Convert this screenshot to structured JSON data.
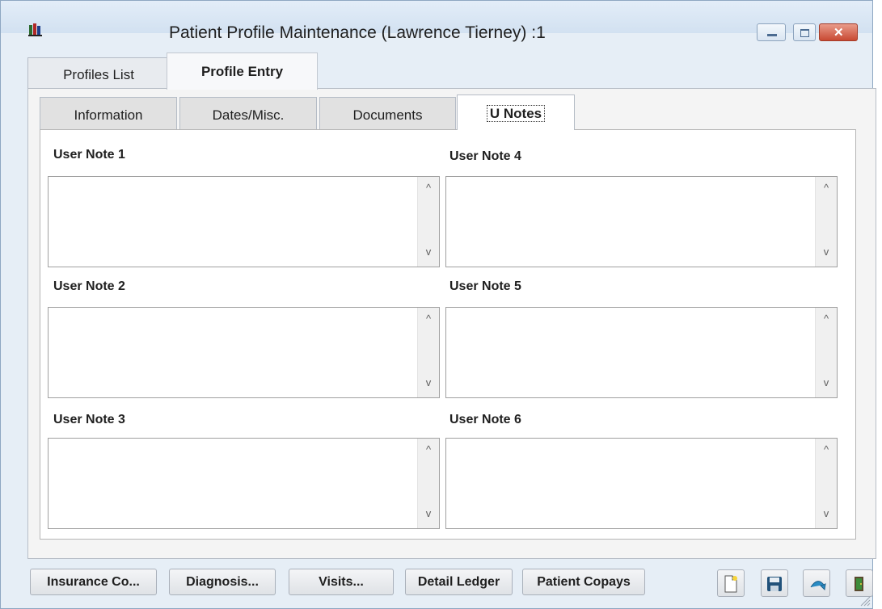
{
  "window": {
    "title": "Patient Profile Maintenance (Lawrence  Tierney) :1"
  },
  "outer_tabs": [
    {
      "label": "Profiles List",
      "active": false
    },
    {
      "label": "Profile Entry",
      "active": true
    }
  ],
  "inner_tabs": [
    {
      "label": "Information",
      "active": false
    },
    {
      "label": "Dates/Misc.",
      "active": false
    },
    {
      "label": "Documents",
      "active": false
    },
    {
      "label": "U Notes",
      "active": true
    }
  ],
  "notes": [
    {
      "label": "User Note 1",
      "value": ""
    },
    {
      "label": "User Note 2",
      "value": ""
    },
    {
      "label": "User Note 3",
      "value": ""
    },
    {
      "label": "User Note 4",
      "value": ""
    },
    {
      "label": "User Note 5",
      "value": ""
    },
    {
      "label": "User Note 6",
      "value": ""
    }
  ],
  "bottom_buttons": [
    {
      "label": "Insurance Co..."
    },
    {
      "label": "Diagnosis..."
    },
    {
      "label": "Visits..."
    },
    {
      "label": "Detail Ledger"
    },
    {
      "label": "Patient Copays"
    }
  ],
  "toolbar_icons": [
    "new-document-icon",
    "save-icon",
    "undo-icon",
    "exit-door-icon"
  ],
  "colors": {
    "window_bg": "#e6eef6",
    "close_button": "#c84a33",
    "panel_bg": "#ffffff"
  }
}
